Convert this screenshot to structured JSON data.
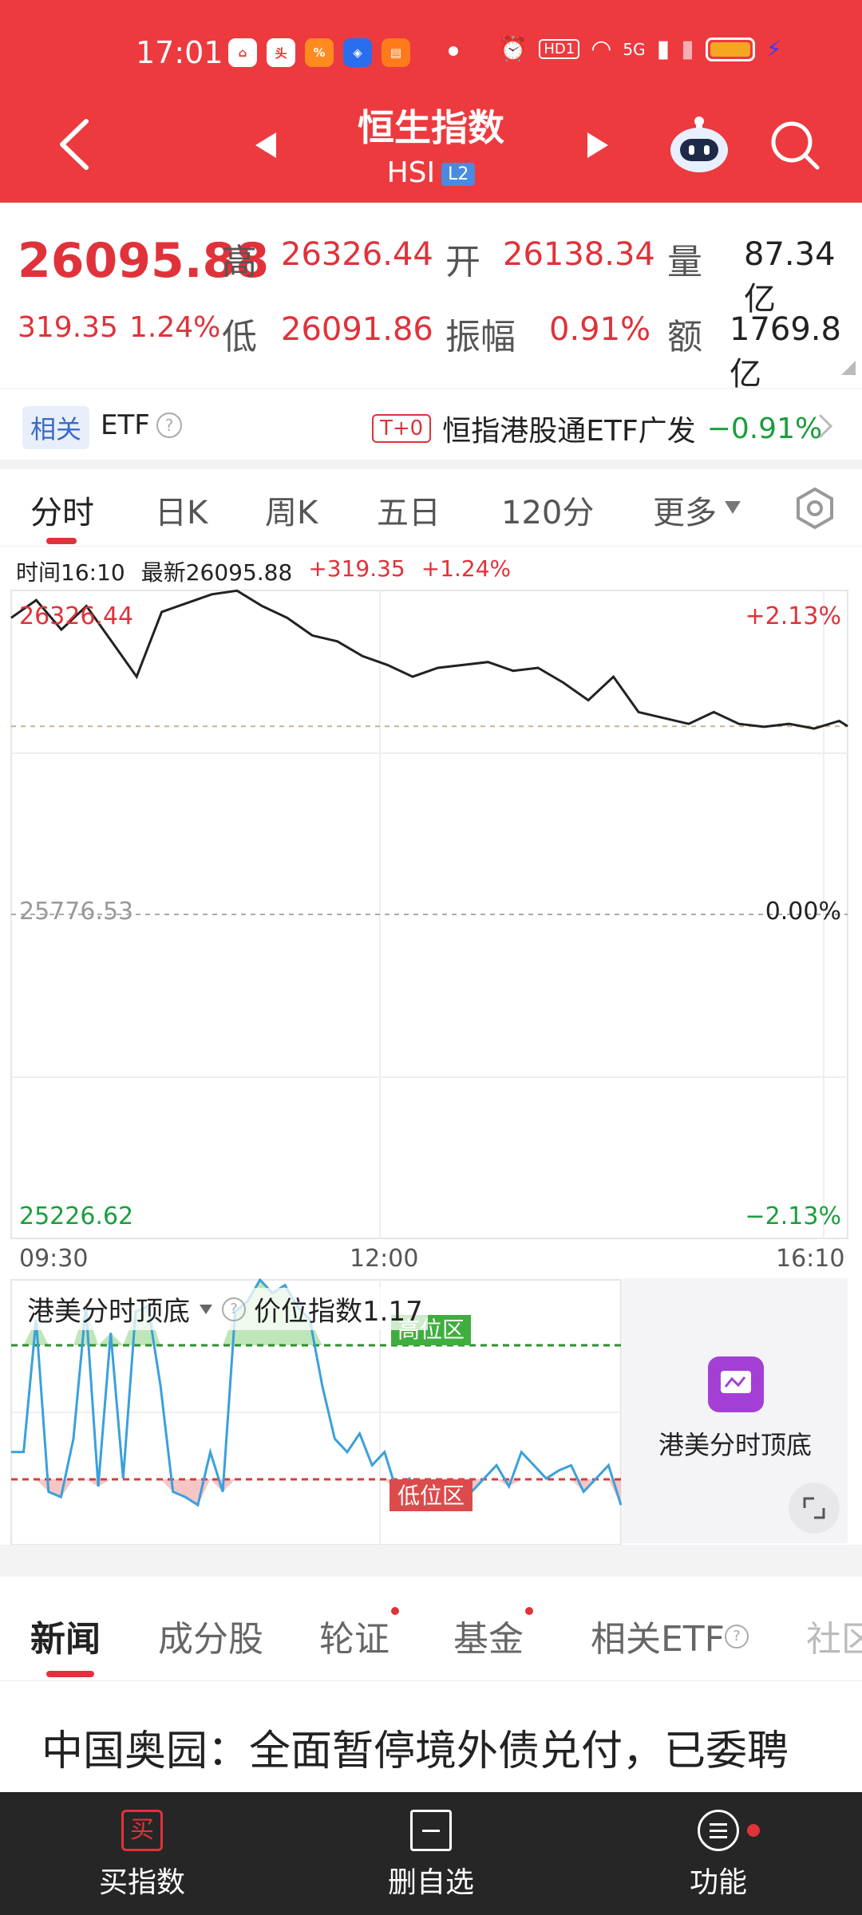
{
  "status_bar": {
    "time": "17:01",
    "app_icons": [
      "home-app-icon",
      "toutiao-app-icon",
      "app-icon",
      "shield-app-icon",
      "book-app-icon"
    ],
    "hd_label": "HD1",
    "network": "5G"
  },
  "header": {
    "title": "恒生指数",
    "subtitle": "HSI",
    "badge": "L2"
  },
  "quote": {
    "price": "26095.88",
    "change": "319.35",
    "change_pct": "1.24%",
    "high_label": "高",
    "high": "26326.44",
    "low_label": "低",
    "low": "26091.86",
    "open_label": "开",
    "open": "26138.34",
    "amp_label": "振幅",
    "amplitude": "0.91%",
    "vol_label": "量",
    "volume": "87.34亿",
    "amt_label": "额",
    "amount": "1769.8亿"
  },
  "etf_row": {
    "tag": "相关",
    "label": "ETF",
    "tplus": "T+0",
    "fund_name": "恒指港股通ETF广发",
    "fund_change": "−0.91%"
  },
  "chart_tabs": [
    "分时",
    "日K",
    "周K",
    "五日",
    "120分",
    "更多"
  ],
  "chart_info": {
    "time_label": "时间16:10",
    "latest_label": "最新26095.88",
    "change": "+319.35",
    "change_pct": "+1.24%"
  },
  "chart_data": {
    "type": "line",
    "title": "",
    "x_ticks": [
      "09:30",
      "12:00",
      "16:10"
    ],
    "y_left_labels": {
      "top": "26326.44",
      "mid": "25776.53",
      "bottom": "25226.62"
    },
    "y_right_labels": {
      "top": "+2.13%",
      "mid": "0.00%",
      "bottom": "−2.13%"
    },
    "ylim": [
      25226.62,
      26326.44
    ],
    "prev_close": 25776.53,
    "current_ref": 26095.88,
    "x": [
      0,
      3,
      6,
      9,
      12,
      15,
      18,
      21,
      24,
      27,
      30,
      33,
      36,
      39,
      42,
      45,
      48,
      51,
      54,
      57,
      60,
      63,
      66,
      69,
      72,
      75,
      78,
      81,
      84,
      87,
      90,
      93,
      96,
      99,
      100
    ],
    "series": [
      {
        "values": [
          26280,
          26310,
          26260,
          26300,
          26240,
          26180,
          26290,
          26305,
          26320,
          26326,
          26300,
          26280,
          26250,
          26240,
          26215,
          26200,
          26180,
          26195,
          26200,
          26205,
          26190,
          26195,
          26170,
          26140,
          26180,
          26120,
          26110,
          26100,
          26120,
          26100,
          26095,
          26100,
          26092,
          26105,
          26096
        ]
      }
    ]
  },
  "indicator": {
    "name": "港美分时顶底",
    "param": "价位指数1.17",
    "high_zone": "高位区",
    "low_zone": "低位区",
    "card_label": "港美分时顶底",
    "values": [
      35,
      35,
      85,
      20,
      18,
      40,
      90,
      22,
      80,
      25,
      88,
      90,
      60,
      20,
      18,
      15,
      35,
      20,
      88,
      92,
      100,
      95,
      98,
      90,
      85,
      60,
      40,
      35,
      42,
      30,
      35,
      20,
      25,
      18,
      20,
      22,
      15,
      20,
      25,
      30,
      22,
      35,
      30,
      25,
      28,
      30,
      20,
      25,
      30,
      15
    ]
  },
  "news_tabs": [
    "新闻",
    "成分股",
    "轮证",
    "基金",
    "相关ETF",
    "社区"
  ],
  "news_headline": "中国奥园：全面暂停境外债兑付，已委聘",
  "bottom_bar": {
    "buy": "买指数",
    "remove": "删自选",
    "func": "功能"
  }
}
